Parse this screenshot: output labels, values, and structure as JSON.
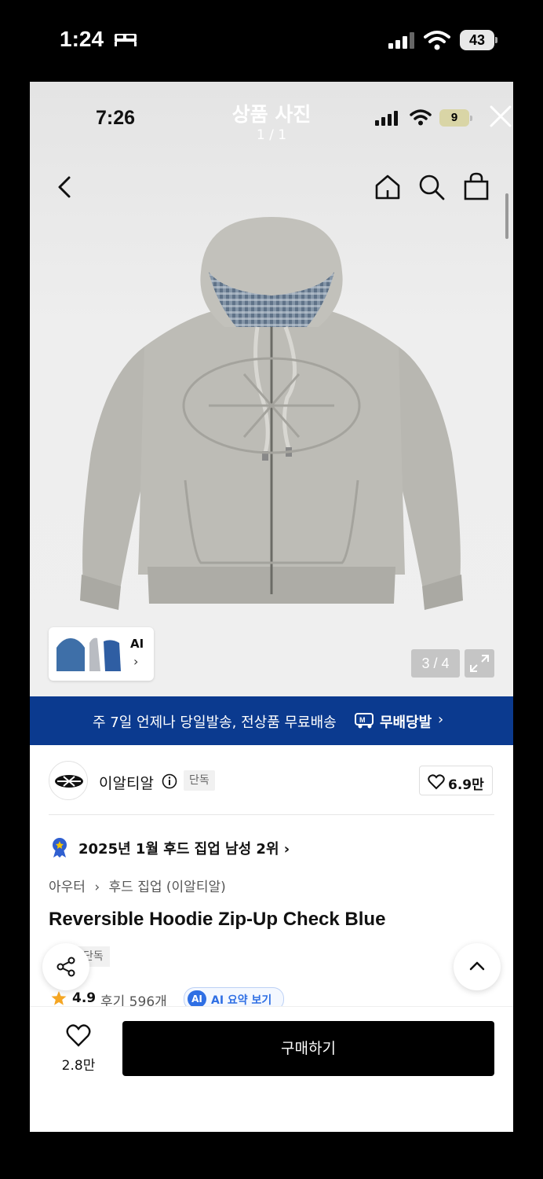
{
  "os_status": {
    "time": "1:24",
    "battery": "43"
  },
  "viewer": {
    "status_time": "7:26",
    "battery": "9",
    "title": "상품 사진",
    "subtitle": "1 / 1"
  },
  "gallery": {
    "ai_label": "AI",
    "ai_chevron": "›",
    "counter": "3 / 4"
  },
  "banner": {
    "text": "주 7일 언제나 당일발송, 전상품 무료배송",
    "logo_text": "무배당발",
    "chevron": "›"
  },
  "brand": {
    "name": "이알티알",
    "badge": "단독",
    "likes": "6.9만"
  },
  "ranking": {
    "text": "2025년 1월 후드 집업 남성 2위 ›"
  },
  "breadcrumb": {
    "category": "아우터",
    "separator": "›",
    "subcategory": "후드 집업 (이알티알)"
  },
  "product": {
    "title": "Reversible Hoodie Zip-Up Check Blue",
    "tag": "단독",
    "rating": "4.9",
    "reviews": "후기 596개",
    "ai_summary_chip": "AI",
    "ai_summary_label": "AI 요약 보기"
  },
  "bottom_bar": {
    "wish_count": "2.8만",
    "buy_label": "구매하기"
  },
  "colors": {
    "banner_bg": "#0b3a8f",
    "buy_bg": "#000000",
    "ai_blue": "#2f6fe4",
    "star": "#f5a623"
  }
}
